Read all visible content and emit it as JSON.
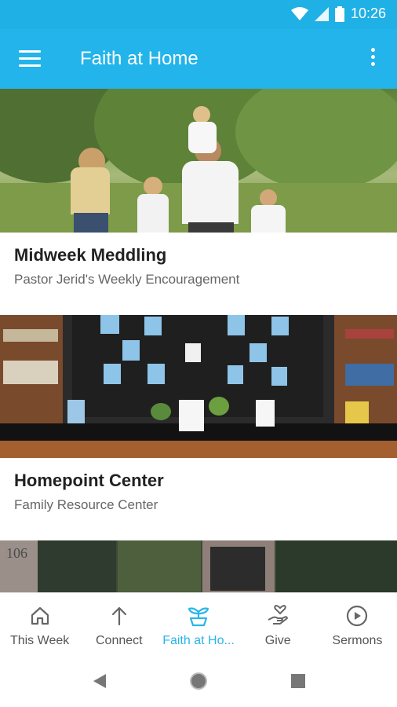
{
  "status": {
    "time": "10:26"
  },
  "app_bar": {
    "title": "Faith at Home"
  },
  "cards": [
    {
      "title": "Midweek Meddling",
      "subtitle": "Pastor Jerid's Weekly Encouragement"
    },
    {
      "title": "Homepoint Center",
      "subtitle": "Family Resource Center"
    }
  ],
  "third_image_text": "106",
  "bottom_nav": {
    "items": [
      {
        "label": "This Week",
        "icon": "home-icon"
      },
      {
        "label": "Connect",
        "icon": "arrow-up-icon"
      },
      {
        "label": "Faith at Ho...",
        "icon": "plant-icon"
      },
      {
        "label": "Give",
        "icon": "heart-hand-icon"
      },
      {
        "label": "Sermons",
        "icon": "play-circle-icon"
      }
    ],
    "active_index": 2,
    "active_color": "#2ab5e8"
  },
  "colors": {
    "primary": "#22b4ea",
    "status_bar": "#1fb0e6"
  }
}
